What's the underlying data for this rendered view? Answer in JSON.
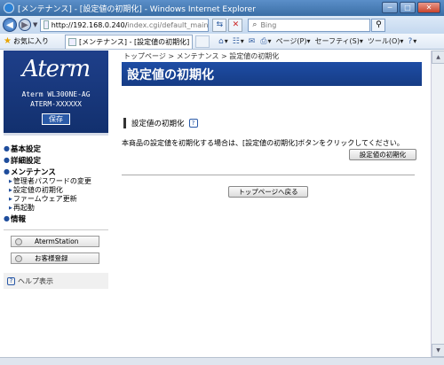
{
  "window": {
    "title": "[メンテナンス] - [設定値の初期化] - Windows Internet Explorer",
    "minimize": "─",
    "maximize": "□",
    "close": "✕"
  },
  "addressbar": {
    "url_host": "http://192.168.0.240/",
    "url_path": "index.cgi/default_main",
    "search_placeholder": "Bing",
    "search_icon": "search-icon",
    "go_icon": "⇆",
    "stop_icon": "✕"
  },
  "favbar": {
    "favorites_label": "お気に入り",
    "tab_label": "[メンテナンス] - [設定値の初期化]",
    "commands": [
      {
        "icon": "⌂",
        "label": ""
      },
      {
        "icon": "☷",
        "label": ""
      },
      {
        "icon": "✉",
        "label": ""
      },
      {
        "icon": "⎙",
        "label": ""
      },
      {
        "icon": "",
        "label": "ページ(P)"
      },
      {
        "icon": "",
        "label": "セーフティ(S)"
      },
      {
        "icon": "",
        "label": "ツール(O)"
      },
      {
        "icon": "?",
        "label": ""
      }
    ]
  },
  "sidebar": {
    "logo": "Aterm",
    "model_line1": "Aterm WL300NE-AG",
    "model_line2": "ATERM-XXXXXX",
    "save_label": "保存",
    "sections": {
      "basic": "基本設定",
      "detail": "詳細設定",
      "maintenance": "メンテナンス",
      "info": "情報"
    },
    "maintenance_items": [
      "管理者パスワードの変更",
      "設定値の初期化",
      "ファームウェア更新",
      "再起動"
    ],
    "aterm_station_label": "AtermStation",
    "register_label": "お客様登録",
    "help_label": "ヘルプ表示"
  },
  "main": {
    "breadcrumb": "トップページ > メンテナンス > 設定値の初期化",
    "page_title": "設定値の初期化",
    "section_title": "設定値の初期化",
    "description": "本商品の設定値を初期化する場合は、[設定値の初期化]ボタンをクリックしてください。",
    "reset_button": "設定値の初期化",
    "top_button": "トップページへ戻る"
  },
  "colors": {
    "header_blue": "#1e4da5",
    "logo_bg": "#1e3f8a"
  }
}
